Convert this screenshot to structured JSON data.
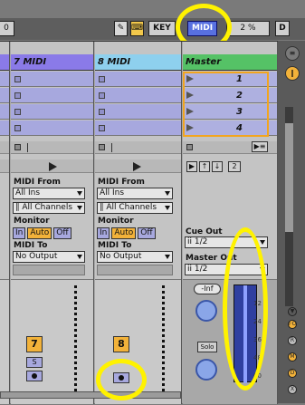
{
  "topbar": {
    "number": "0",
    "pencil_label": "✎",
    "kbd_label": "⌨",
    "key_label": "KEY",
    "midi_label": "MIDI",
    "percent": "2 %",
    "d_label": "D"
  },
  "tracks": [
    {
      "name": "7 MIDI",
      "midi_from_label": "MIDI From",
      "midi_from_value": "All Ins",
      "channel_value": "∥ All Channels",
      "monitor_label": "Monitor",
      "monitor_in": "In",
      "monitor_auto": "Auto",
      "monitor_off": "Off",
      "midi_to_label": "MIDI To",
      "midi_to_value": "No Output",
      "number": "7",
      "solo": "S"
    },
    {
      "name": "8 MIDI",
      "midi_from_label": "MIDI From",
      "midi_from_value": "All Ins",
      "channel_value": "∥ All Channels",
      "monitor_label": "Monitor",
      "monitor_in": "In",
      "monitor_auto": "Auto",
      "monitor_off": "Off",
      "midi_to_label": "MIDI To",
      "midi_to_value": "No Output",
      "number": "8",
      "solo": "S"
    }
  ],
  "master": {
    "name": "Master",
    "scenes": [
      "1",
      "2",
      "3",
      "4"
    ],
    "tempo_value": "2",
    "cue_out_label": "Cue Out",
    "cue_out_value": "ii 1/2",
    "master_out_label": "Master Out",
    "master_out_value": "ii 1/2",
    "volume": "-Inf",
    "solo": "Solo",
    "scale": [
      "0",
      "12",
      "24",
      "36",
      "48",
      "60"
    ]
  },
  "sidebar": {
    "icons": [
      "menu-icon",
      "bars-icon"
    ],
    "io": [
      "I·O",
      "R",
      "M",
      "D",
      "X"
    ]
  },
  "colors": {
    "track7": "#8a7ae8",
    "track8": "#8ed0ee",
    "master": "#55c266",
    "accent": "#f2a51f",
    "highlight": "#fff200",
    "midi_active": "#5870e0"
  }
}
